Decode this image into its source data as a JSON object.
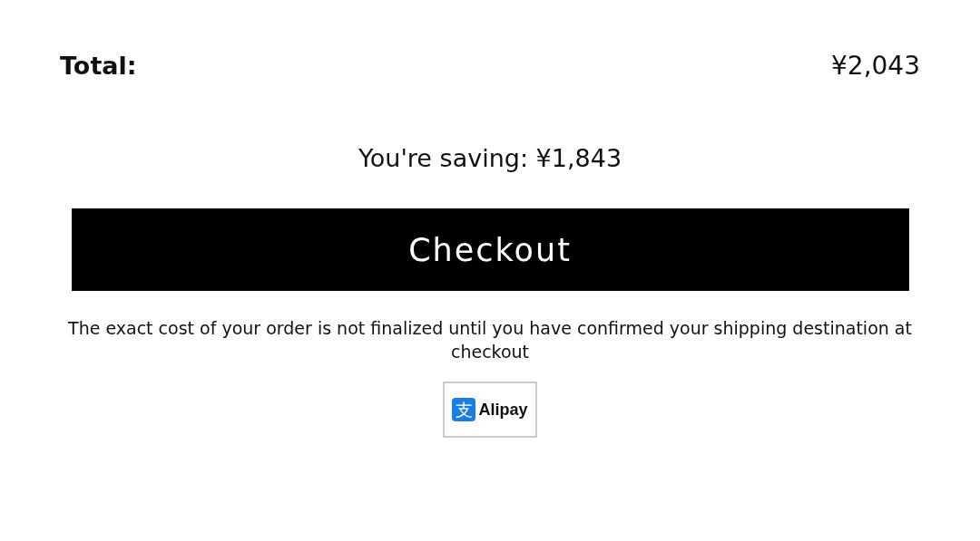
{
  "total": {
    "label": "Total:",
    "amount": "¥2,043"
  },
  "saving": "You're saving: ¥1,843",
  "checkout_button": "Checkout",
  "note": "The exact cost of your order is not finalized until you have confirmed your shipping destination at checkout",
  "payment_badge": {
    "mark": "支",
    "name": "Alipay"
  }
}
